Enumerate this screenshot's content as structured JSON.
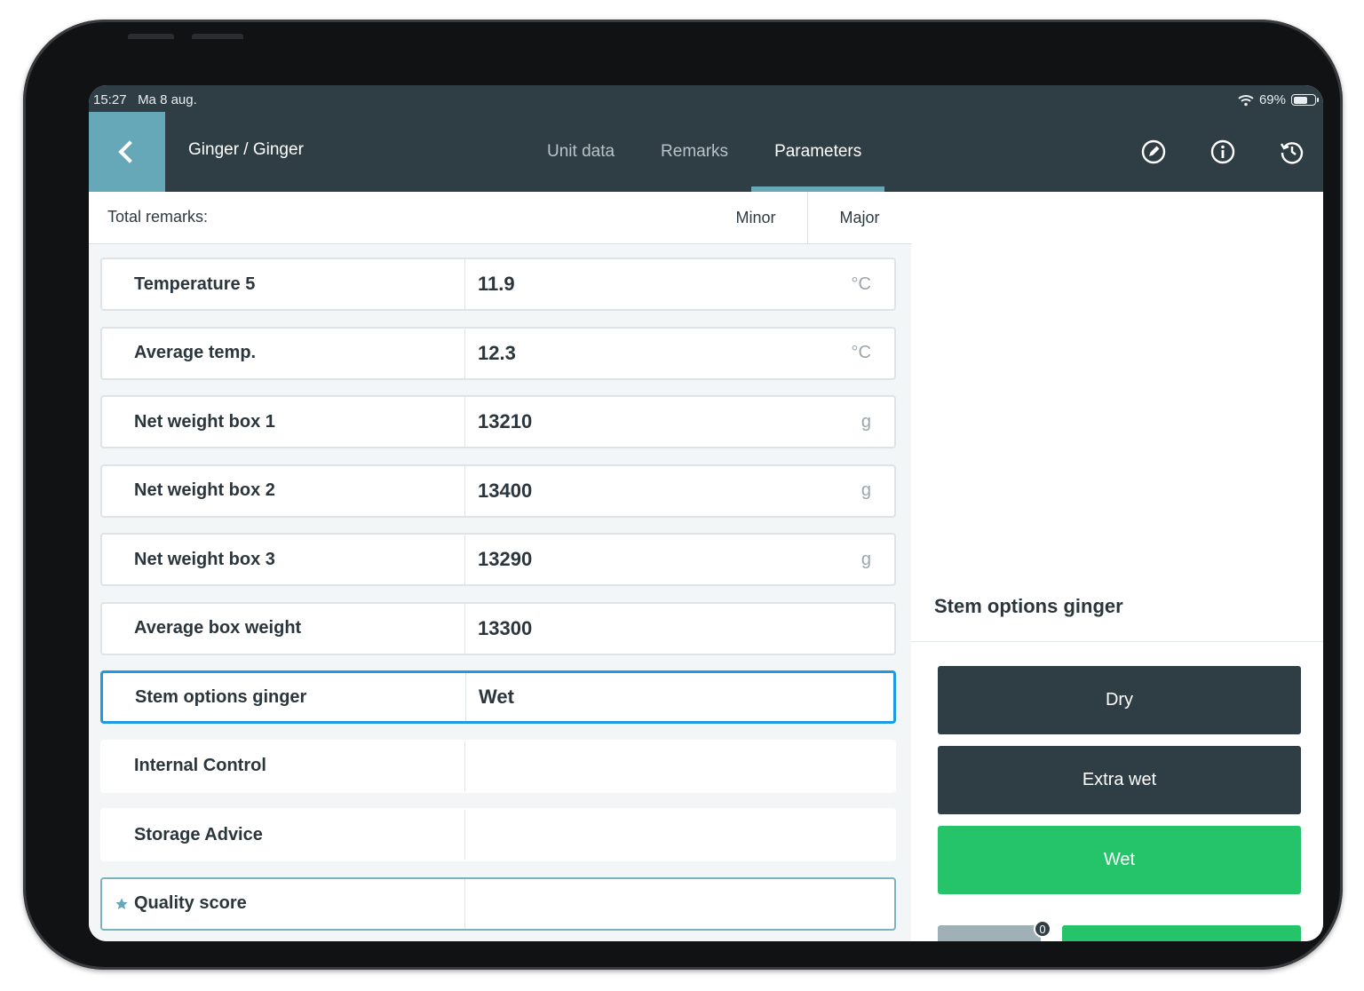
{
  "status_bar": {
    "time": "15:27",
    "date": "Ma 8 aug.",
    "battery_percent": "69%",
    "battery_level": 0.69,
    "wifi_icon": "wifi-icon"
  },
  "header": {
    "breadcrumb": "Ginger / Ginger",
    "tabs": [
      {
        "label": "Unit data",
        "active": false
      },
      {
        "label": "Remarks",
        "active": false
      },
      {
        "label": "Parameters",
        "active": true
      }
    ],
    "icons": [
      "edit-compass-icon",
      "info-icon",
      "history-icon"
    ]
  },
  "remarks_bar": {
    "label": "Total remarks:",
    "minor": "Minor",
    "major": "Major"
  },
  "parameters": [
    {
      "label": "Temperature 5",
      "value": "11.9",
      "unit": "°C"
    },
    {
      "label": "Average temp.",
      "value": "12.3",
      "unit": "°C"
    },
    {
      "label": "Net weight box 1",
      "value": "13210",
      "unit": "g"
    },
    {
      "label": "Net weight box 2",
      "value": "13400",
      "unit": "g"
    },
    {
      "label": "Net weight box 3",
      "value": "13290",
      "unit": "g"
    },
    {
      "label": "Average box weight",
      "value": "13300",
      "unit": ""
    },
    {
      "label": "Stem options ginger",
      "value": "Wet",
      "unit": "",
      "selected": true
    },
    {
      "label": "Internal Control",
      "value": "",
      "unit": ""
    },
    {
      "label": "Storage Advice",
      "value": "",
      "unit": ""
    },
    {
      "label": "Quality score",
      "value": "",
      "unit": "",
      "starred": true
    }
  ],
  "options_panel": {
    "title": "Stem options ginger",
    "options": [
      {
        "label": "Dry",
        "selected": false
      },
      {
        "label": "Extra wet",
        "selected": false
      },
      {
        "label": "Wet",
        "selected": true
      }
    ],
    "badge_count": "0"
  },
  "colors": {
    "header": "#2f3d44",
    "accent": "#66a8b8",
    "selected_border": "#1e9be0",
    "selected_option": "#26c46a"
  }
}
